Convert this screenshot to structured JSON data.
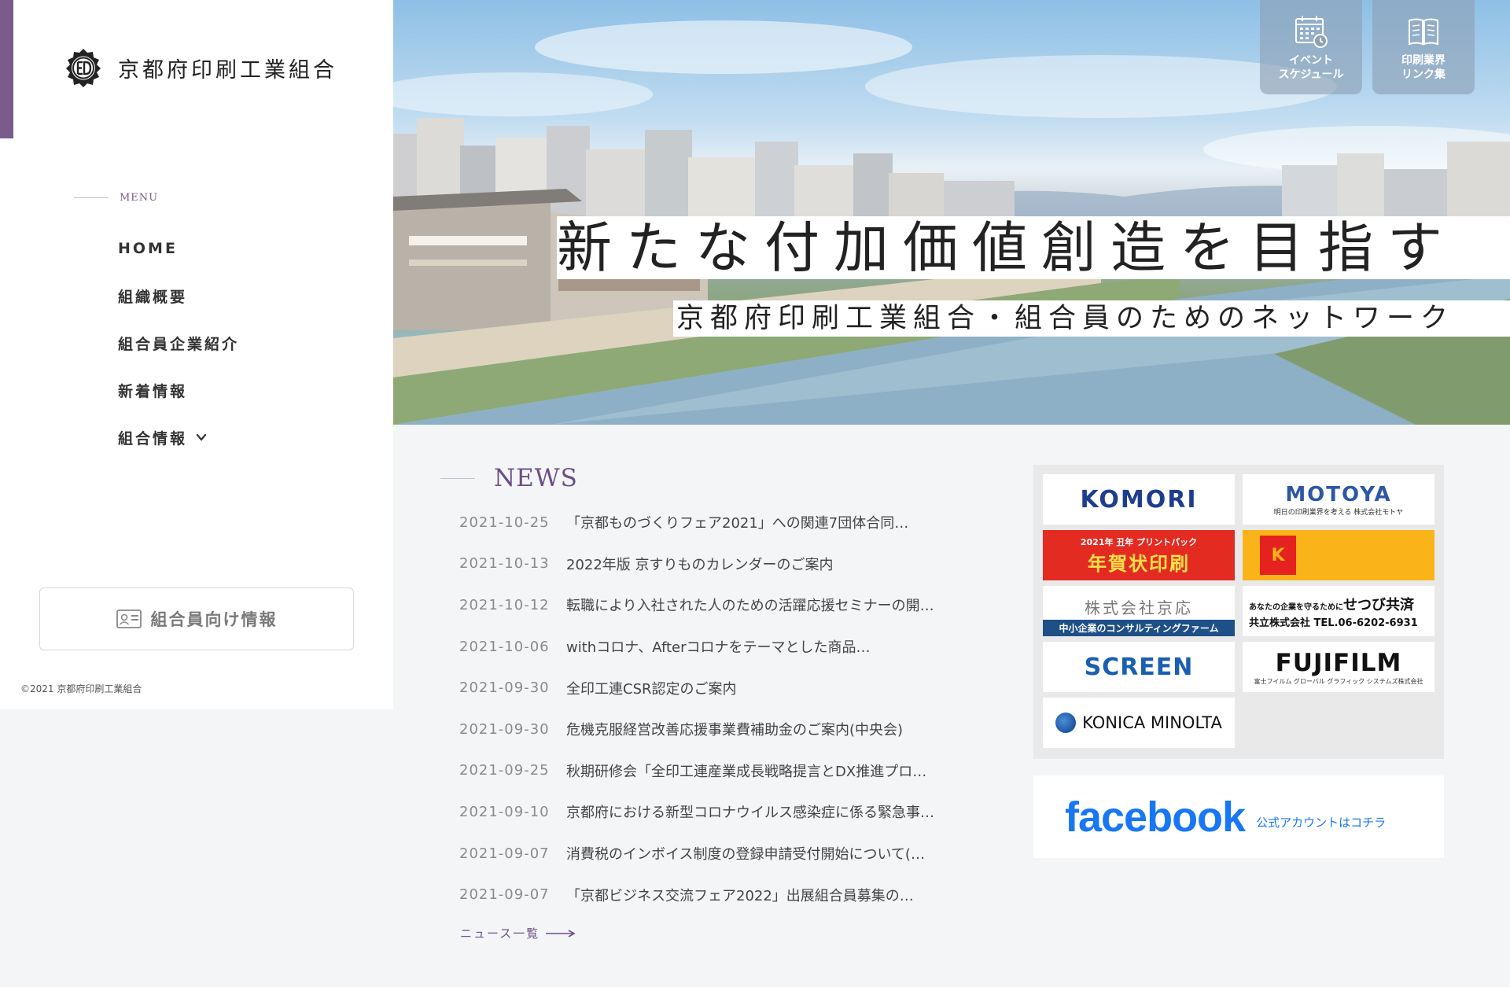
{
  "site": {
    "logo_text": "京都府印刷工業組合",
    "copyright": "©2021 京都府印刷工業組合"
  },
  "menu": {
    "heading": "MENU",
    "items": [
      {
        "label": "HOME"
      },
      {
        "label": "組織概要"
      },
      {
        "label": "組合員企業紹介"
      },
      {
        "label": "新着情報"
      },
      {
        "label": "組合情報"
      }
    ]
  },
  "member_button": {
    "label": "組合員向け情報"
  },
  "hero": {
    "tagline": "新たな付加価値創造を目指す",
    "subtagline": "京都府印刷工業組合・組合員のためのネットワーク"
  },
  "quick_links": [
    {
      "label_line1": "イベント",
      "label_line2": "スケジュール",
      "icon": "calendar-icon"
    },
    {
      "label_line1": "印刷業界",
      "label_line2": "リンク集",
      "icon": "book-icon"
    }
  ],
  "news": {
    "title": "NEWS",
    "more_label": "ニュース一覧",
    "items": [
      {
        "date": "2021-10-25",
        "text": "「京都ものづくりフェア2021」への関連7団体合同…"
      },
      {
        "date": "2021-10-13",
        "text": "2022年版 京すりものカレンダーのご案内"
      },
      {
        "date": "2021-10-12",
        "text": "転職により入社された人のための活躍応援セミナーの開…"
      },
      {
        "date": "2021-10-06",
        "text": "withコロナ、Afterコロナをテーマとした商品…"
      },
      {
        "date": "2021-09-30",
        "text": "全印工連CSR認定のご案内"
      },
      {
        "date": "2021-09-30",
        "text": "危機克服経営改善応援事業費補助金のご案内(中央会)"
      },
      {
        "date": "2021-09-25",
        "text": "秋期研修会「全印工連産業成長戦略提言とDX推進プロ…"
      },
      {
        "date": "2021-09-10",
        "text": "京都府における新型コロナウイルス感染症に係る緊急事…"
      },
      {
        "date": "2021-09-07",
        "text": "消費税のインボイス制度の登録申請受付開始について(…"
      },
      {
        "date": "2021-09-07",
        "text": "「京都ビジネス交流フェア2022」出展組合員募集の…"
      }
    ]
  },
  "banners": {
    "komori": "KOMORI",
    "motoya": {
      "name": "MOTOYA",
      "tagline": "明日の印刷業界を考える 株式会社モトヤ"
    },
    "nenga": {
      "top": "2021年 丑年 プリントパック",
      "main": "年賀状印刷"
    },
    "kodak": {
      "mark": "K"
    },
    "keio": {
      "name": "株式会社京応",
      "bar": "中小企業のコンサルティングファーム"
    },
    "setsubi": {
      "line1_prefix": "あなたの企業を守るために",
      "line1_main": "せつび共済",
      "line2": "共立株式会社 TEL.06-6202-6931"
    },
    "screen": "SCREEN",
    "fujifilm": {
      "name": "FUJIFILM",
      "tagline": "富士フイルム グローバル グラフィック システムズ株式会社"
    },
    "konica": "KONICA MINOLTA"
  },
  "facebook": {
    "logo": "facebook",
    "note": "公式アカウントはコチラ"
  },
  "colors": {
    "accent": "#7b5a8c",
    "news_title": "#6b4f85",
    "facebook": "#1877f2"
  }
}
